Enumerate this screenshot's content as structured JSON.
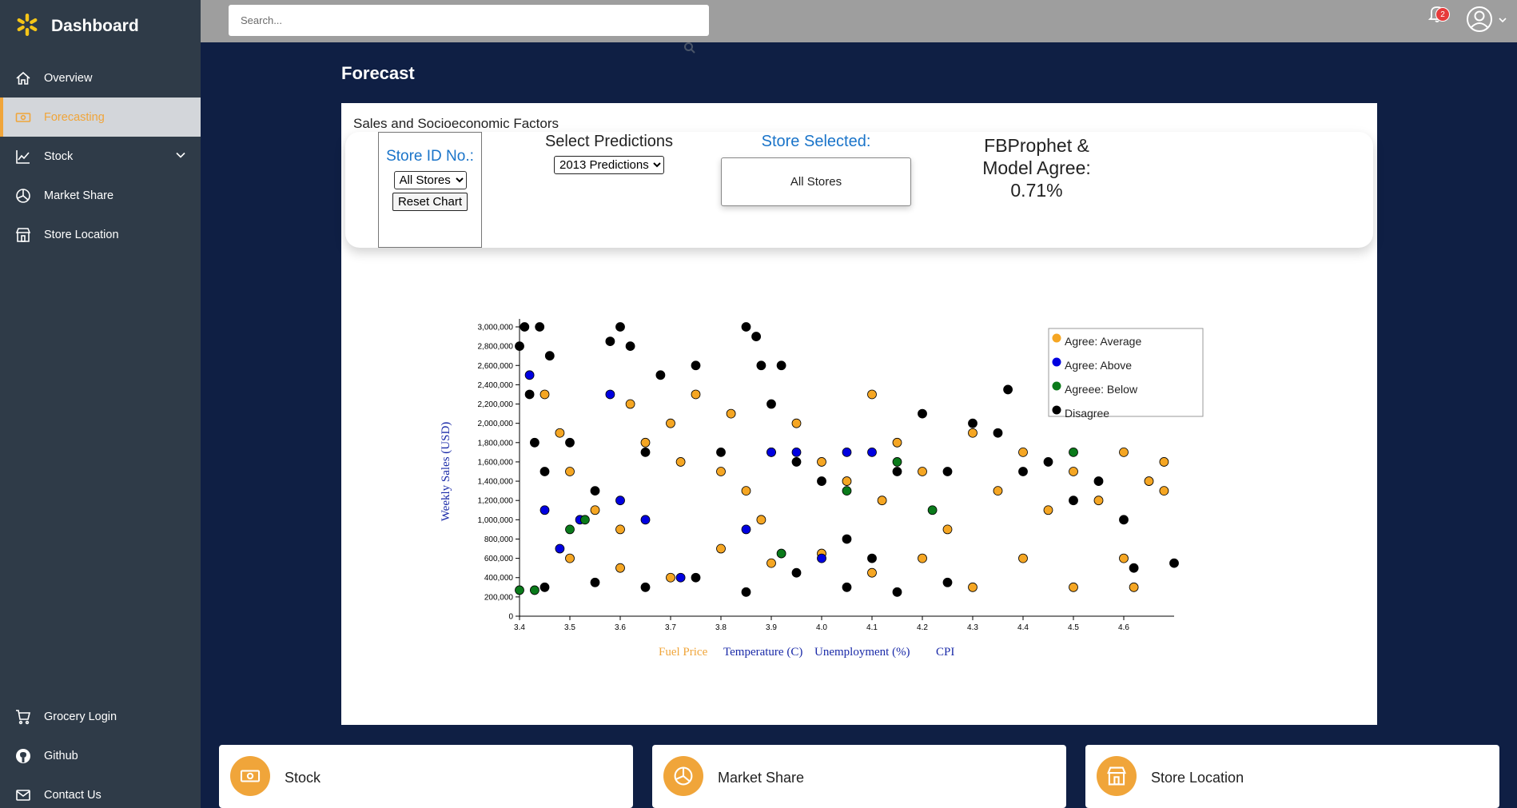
{
  "sidebar": {
    "brand": "Dashboard",
    "items": [
      {
        "label": "Overview",
        "icon": "home-icon"
      },
      {
        "label": "Forecasting",
        "icon": "money-icon",
        "active": true
      },
      {
        "label": "Stock",
        "icon": "trend-icon"
      },
      {
        "label": "Market Share",
        "icon": "pie-icon"
      },
      {
        "label": "Store Location",
        "icon": "store-icon"
      }
    ],
    "footer_items": [
      {
        "label": "Grocery Login",
        "icon": "cart-icon"
      },
      {
        "label": "Github",
        "icon": "github-icon"
      },
      {
        "label": "Contact Us",
        "icon": "mail-icon"
      }
    ]
  },
  "topbar": {
    "search_placeholder": "Search...",
    "notification_count": "2"
  },
  "page": {
    "title": "Forecast"
  },
  "panel": {
    "title": "Sales and Socioeconomic Factors",
    "store_id_label": "Store ID No.:",
    "store_select_value": "All Stores",
    "reset_label": "Reset Chart",
    "predictions_label": "Select Predictions",
    "predictions_value": "2013 Predictions",
    "store_selected_label": "Store Selected:",
    "store_selected_value": "All Stores",
    "agree_line1": "FBProphet &",
    "agree_line2": "Model Agree:",
    "agree_value": "0.71%"
  },
  "colors": {
    "accent": "#f0a53a",
    "link_blue": "#1a74c9",
    "agree_average": "#f5a623",
    "agree_above": "#0000e0",
    "agree_below": "#0a7a1a",
    "disagree": "#000000"
  },
  "chart_data": {
    "type": "scatter",
    "xlabel": "",
    "ylabel": "Weekly Sales (USD)",
    "xlim": [
      3.4,
      4.7
    ],
    "ylim": [
      0,
      3000000
    ],
    "x_ticks": [
      "3.4",
      "3.5",
      "3.6",
      "3.7",
      "3.8",
      "3.9",
      "4.0",
      "4.1",
      "4.2",
      "4.3",
      "4.4",
      "4.5",
      "4.6"
    ],
    "y_ticks": [
      "0",
      "200,000",
      "400,000",
      "600,000",
      "800,000",
      "1,000,000",
      "1,200,000",
      "1,400,000",
      "1,600,000",
      "1,800,000",
      "2,000,000",
      "2,200,000",
      "2,400,000",
      "2,600,000",
      "2,800,000",
      "3,000,000"
    ],
    "factor_buttons": [
      "Fuel Price",
      "Temperature (C)",
      "Unemployment (%)",
      "CPI"
    ],
    "legend_placement": "top-right",
    "series": [
      {
        "name": "Agree: Average",
        "color": "#f5a623",
        "points": [
          [
            3.45,
            2300000
          ],
          [
            3.48,
            1900000
          ],
          [
            3.5,
            1500000
          ],
          [
            3.55,
            1100000
          ],
          [
            3.6,
            900000
          ],
          [
            3.62,
            2200000
          ],
          [
            3.65,
            1800000
          ],
          [
            3.7,
            2000000
          ],
          [
            3.72,
            1600000
          ],
          [
            3.75,
            2300000
          ],
          [
            3.8,
            1500000
          ],
          [
            3.82,
            2100000
          ],
          [
            3.85,
            1300000
          ],
          [
            3.88,
            1000000
          ],
          [
            3.9,
            1700000
          ],
          [
            3.95,
            2000000
          ],
          [
            4.0,
            1600000
          ],
          [
            4.05,
            1400000
          ],
          [
            4.1,
            2300000
          ],
          [
            4.12,
            1200000
          ],
          [
            4.15,
            1800000
          ],
          [
            4.2,
            1500000
          ],
          [
            4.25,
            900000
          ],
          [
            4.3,
            1900000
          ],
          [
            4.35,
            1300000
          ],
          [
            4.4,
            1700000
          ],
          [
            4.45,
            1100000
          ],
          [
            4.5,
            1500000
          ],
          [
            4.55,
            1200000
          ],
          [
            4.6,
            1700000
          ],
          [
            4.65,
            1400000
          ],
          [
            3.5,
            600000
          ],
          [
            3.6,
            500000
          ],
          [
            3.7,
            400000
          ],
          [
            3.8,
            700000
          ],
          [
            3.9,
            550000
          ],
          [
            4.0,
            650000
          ],
          [
            4.1,
            450000
          ],
          [
            4.2,
            600000
          ],
          [
            4.3,
            300000
          ],
          [
            4.4,
            600000
          ],
          [
            4.5,
            300000
          ],
          [
            4.6,
            600000
          ],
          [
            4.62,
            300000
          ],
          [
            4.68,
            1300000
          ],
          [
            4.68,
            1600000
          ]
        ]
      },
      {
        "name": "Agree: Above",
        "color": "#0000e0",
        "points": [
          [
            3.42,
            2500000
          ],
          [
            3.45,
            1100000
          ],
          [
            3.52,
            1000000
          ],
          [
            3.6,
            1200000
          ],
          [
            3.65,
            1000000
          ],
          [
            3.85,
            900000
          ],
          [
            3.9,
            1700000
          ],
          [
            3.95,
            1700000
          ],
          [
            4.0,
            600000
          ],
          [
            4.05,
            1700000
          ],
          [
            4.1,
            1700000
          ],
          [
            3.58,
            2300000
          ],
          [
            3.72,
            400000
          ],
          [
            3.48,
            700000
          ]
        ]
      },
      {
        "name": "Agreee: Below",
        "color": "#0a7a1a",
        "points": [
          [
            3.4,
            270000
          ],
          [
            3.43,
            270000
          ],
          [
            3.5,
            900000
          ],
          [
            3.53,
            1000000
          ],
          [
            3.92,
            650000
          ],
          [
            4.05,
            1300000
          ],
          [
            4.15,
            1600000
          ],
          [
            4.22,
            1100000
          ],
          [
            4.5,
            1700000
          ]
        ]
      },
      {
        "name": "Disagree",
        "color": "#000000",
        "points": [
          [
            3.4,
            2800000
          ],
          [
            3.41,
            3000000
          ],
          [
            3.44,
            3000000
          ],
          [
            3.46,
            2700000
          ],
          [
            3.42,
            2300000
          ],
          [
            3.43,
            1800000
          ],
          [
            3.45,
            1500000
          ],
          [
            3.5,
            1800000
          ],
          [
            3.55,
            1300000
          ],
          [
            3.58,
            2850000
          ],
          [
            3.6,
            3000000
          ],
          [
            3.62,
            2800000
          ],
          [
            3.65,
            1700000
          ],
          [
            3.68,
            2500000
          ],
          [
            3.75,
            2600000
          ],
          [
            3.8,
            1700000
          ],
          [
            3.85,
            3000000
          ],
          [
            3.87,
            2900000
          ],
          [
            3.88,
            2600000
          ],
          [
            3.9,
            2200000
          ],
          [
            3.92,
            2600000
          ],
          [
            3.95,
            1600000
          ],
          [
            4.0,
            1400000
          ],
          [
            4.05,
            800000
          ],
          [
            4.1,
            600000
          ],
          [
            4.15,
            1500000
          ],
          [
            4.2,
            2100000
          ],
          [
            4.25,
            1500000
          ],
          [
            4.3,
            2000000
          ],
          [
            4.35,
            1900000
          ],
          [
            4.37,
            2350000
          ],
          [
            4.4,
            1500000
          ],
          [
            4.45,
            1600000
          ],
          [
            4.5,
            1200000
          ],
          [
            4.55,
            1400000
          ],
          [
            4.6,
            1000000
          ],
          [
            4.62,
            500000
          ],
          [
            4.7,
            550000
          ],
          [
            3.45,
            300000
          ],
          [
            3.55,
            350000
          ],
          [
            3.65,
            300000
          ],
          [
            3.75,
            400000
          ],
          [
            3.85,
            250000
          ],
          [
            3.95,
            450000
          ],
          [
            4.05,
            300000
          ],
          [
            4.15,
            250000
          ],
          [
            4.25,
            350000
          ]
        ]
      }
    ]
  },
  "cards": [
    {
      "title": "Stock",
      "icon": "money-icon"
    },
    {
      "title": "Market Share",
      "icon": "pie-icon"
    },
    {
      "title": "Store Location",
      "icon": "store-icon"
    }
  ]
}
